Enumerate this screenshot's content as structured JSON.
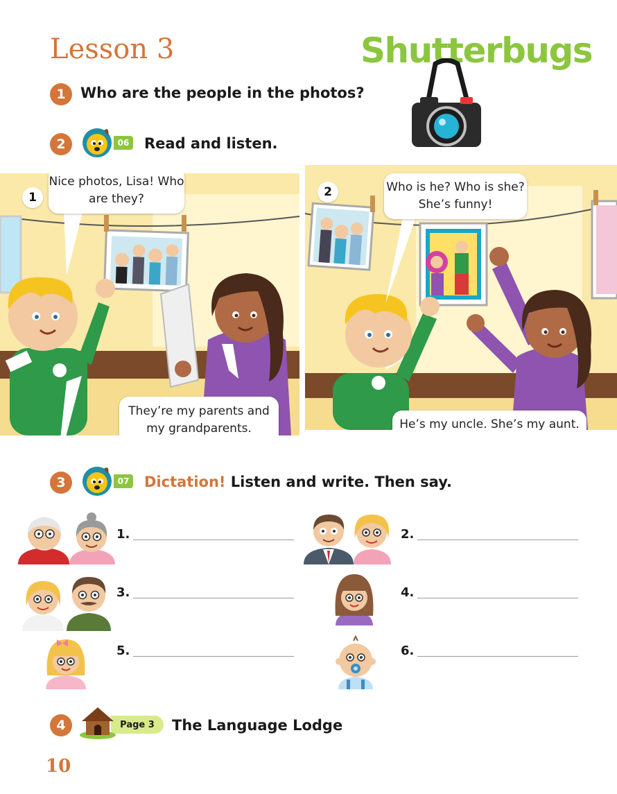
{
  "header": {
    "lesson": "Lesson 3",
    "unit": "Shutterbugs"
  },
  "exercises": [
    {
      "number": "1",
      "instruction": "Who are the people in the photos?"
    },
    {
      "number": "2",
      "track": "06",
      "instruction": "Read and listen."
    },
    {
      "number": "3",
      "track": "07",
      "label": "Dictation!",
      "instruction": "Listen and write. Then say."
    },
    {
      "number": "4",
      "page_ref": "Page 3",
      "instruction": "The Language Lodge"
    }
  ],
  "comic": [
    {
      "number": "1",
      "bubbles": [
        "Nice photos, Lisa! Who are they?",
        "They’re my parents and my grandparents."
      ]
    },
    {
      "number": "2",
      "bubbles": [
        "Who is he? Who is she? She’s funny!",
        "He’s my uncle. She’s my aunt. I’m her favorite niece."
      ]
    }
  ],
  "dictation_items": [
    {
      "number": "1.",
      "icon": "grandparents-icon"
    },
    {
      "number": "2.",
      "icon": "uncle-aunt-icon"
    },
    {
      "number": "3.",
      "icon": "parents-icon"
    },
    {
      "number": "4.",
      "icon": "girl-brown-hair-icon"
    },
    {
      "number": "5.",
      "icon": "girl-blonde-icon"
    },
    {
      "number": "6.",
      "icon": "baby-icon"
    }
  ],
  "footer": {
    "page_number": "10"
  },
  "colors": {
    "accent_orange": "#d4753a",
    "accent_green": "#8cc63f",
    "pill_green": "#d8eb8a"
  }
}
